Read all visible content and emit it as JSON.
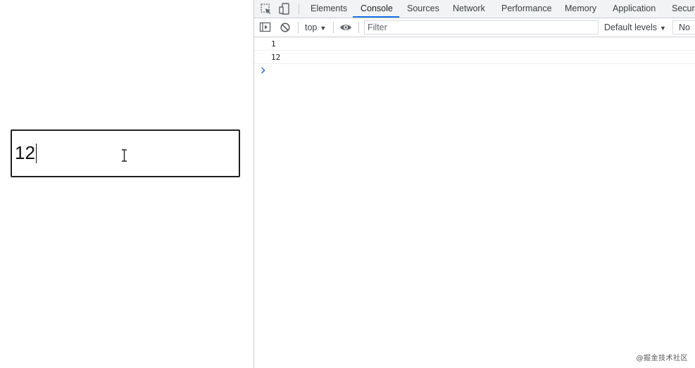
{
  "page": {
    "input_value": "12"
  },
  "devtools": {
    "tabs": [
      {
        "label": "Elements",
        "active": false
      },
      {
        "label": "Console",
        "active": true
      },
      {
        "label": "Sources",
        "active": false
      },
      {
        "label": "Network",
        "active": false
      },
      {
        "label": "Performance",
        "active": false
      },
      {
        "label": "Memory",
        "active": false
      },
      {
        "label": "Application",
        "active": false
      },
      {
        "label": "Securi",
        "active": false
      }
    ],
    "toolbar": {
      "context": "top",
      "filter_placeholder": "Filter",
      "levels": "Default levels",
      "overflow_button": "No"
    },
    "console_lines": [
      "1",
      "12"
    ],
    "icons": [
      "inspect-element-icon",
      "device-toolbar-icon",
      "sidebar-toggle-icon",
      "clear-console-icon",
      "eye-icon",
      "prompt-chevron-icon"
    ],
    "accent_color": "#1a73e8"
  },
  "watermark": "@掘金技术社区"
}
